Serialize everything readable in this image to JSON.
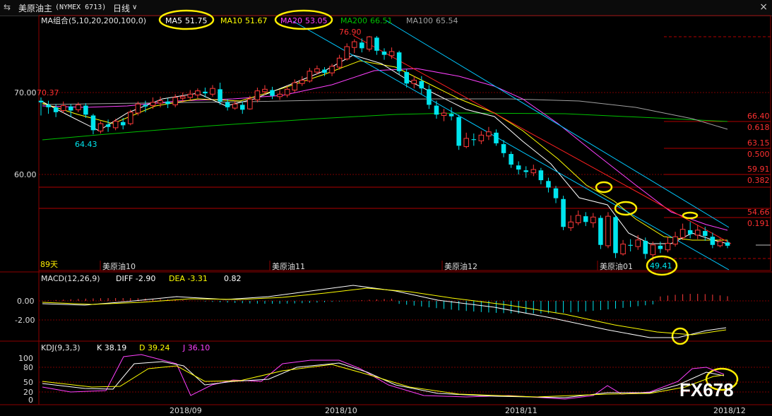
{
  "window": {
    "title": "美原油主",
    "code": "(NYMEX 6713)",
    "period": "日线",
    "close_label": "×"
  },
  "watermark": "FX678",
  "colors": {
    "up": "#ff3a3a",
    "down": "#00e5ee",
    "ma5": "#ffffff",
    "ma10": "#ffff00",
    "ma20": "#ff40ff",
    "ma200": "#00c000",
    "ma100": "#a0a0a0",
    "grid": "#7a0000",
    "annot": "#ffee00"
  },
  "main": {
    "ma_group_label": "MA组合(5,10,20,200,100,0)",
    "legend": [
      {
        "name": "MA5",
        "value": "51.75",
        "color": "#ffffff"
      },
      {
        "name": "MA10",
        "value": "51.67",
        "color": "#ffff00"
      },
      {
        "name": "MA20",
        "value": "53.05",
        "color": "#ff40ff"
      },
      {
        "name": "MA200",
        "value": "66.51",
        "color": "#00c000"
      },
      {
        "name": "MA100",
        "value": "65.54",
        "color": "#a0a0a0"
      }
    ],
    "y_ticks": [
      "70.00",
      "60.00"
    ],
    "annotations": {
      "high": "76.90",
      "low_left": "64.43",
      "low_right": "49.41",
      "p70": "70.37"
    },
    "fib": [
      {
        "price": "66.40",
        "ratio": "0.618"
      },
      {
        "price": "63.15",
        "ratio": "0.500"
      },
      {
        "price": "59.91",
        "ratio": "0.382"
      },
      {
        "price": "54.66",
        "ratio": "0.191"
      }
    ],
    "days_label": "89天",
    "contract_labels": [
      "美原油10",
      "美原油11",
      "美原油12",
      "美原油01"
    ]
  },
  "macd": {
    "title": "MACD(12,26,9)",
    "diff": "DIFF -2.90",
    "dea": "DEA -3.31",
    "macd": "0.82",
    "y_ticks": [
      "0.00",
      "-2.00"
    ]
  },
  "kdj": {
    "title": "KDJ(9,3,3)",
    "k": "K 38.19",
    "d": "D 39.24",
    "j": "J 36.10",
    "y_ticks": [
      "100",
      "80",
      "50",
      "20",
      "0"
    ]
  },
  "x_axis": [
    "2018/09",
    "2018/10",
    "2018/11",
    "2018/12"
  ],
  "chart_data": {
    "type": "candlestick",
    "ylim": [
      49,
      79
    ],
    "candles": [
      [
        69,
        68.8,
        67.2,
        69.4
      ],
      [
        68.5,
        68.2,
        67.4,
        69
      ],
      [
        68.2,
        67.6,
        67,
        68.6
      ],
      [
        67.8,
        68.4,
        67.5,
        68.9
      ],
      [
        68.3,
        67.8,
        67,
        68.6
      ],
      [
        67.9,
        68.5,
        67.6,
        68.8
      ],
      [
        68.4,
        67.3,
        66.9,
        68.7
      ],
      [
        67.2,
        65.4,
        64.9,
        67.4
      ],
      [
        65.3,
        66.2,
        65,
        66.5
      ],
      [
        66.1,
        65.8,
        65.2,
        66.7
      ],
      [
        65.7,
        66.5,
        65.4,
        66.8
      ],
      [
        66.4,
        66,
        65.5,
        66.9
      ],
      [
        66.2,
        67.6,
        66,
        67.9
      ],
      [
        67.5,
        68.6,
        67.2,
        68.9
      ],
      [
        68.5,
        68.3,
        67.6,
        69
      ],
      [
        68.4,
        68.8,
        68,
        69.4
      ],
      [
        68.7,
        69,
        68.2,
        69.5
      ],
      [
        68.9,
        68.6,
        68.1,
        69.3
      ],
      [
        68.5,
        69.4,
        68.2,
        69.8
      ],
      [
        69.3,
        69.5,
        68.8,
        70
      ],
      [
        69.4,
        69.8,
        69.1,
        70.3
      ],
      [
        69.7,
        70.2,
        69.3,
        70.5
      ],
      [
        70.1,
        69.9,
        69.4,
        70.6
      ],
      [
        69.8,
        70.5,
        69.5,
        70.9
      ],
      [
        70.4,
        68.9,
        68.5,
        71.2
      ],
      [
        68.8,
        68.2,
        67.8,
        69.2
      ],
      [
        68.1,
        68.6,
        67.9,
        69
      ],
      [
        68.5,
        67.9,
        67.4,
        68.9
      ],
      [
        68,
        69.2,
        67.9,
        69.6
      ],
      [
        69.1,
        70.2,
        68.8,
        70.6
      ],
      [
        70.1,
        70.4,
        69.7,
        70.9
      ],
      [
        70.3,
        69.6,
        69.2,
        70.7
      ],
      [
        69.5,
        69.8,
        69.1,
        70.3
      ],
      [
        69.7,
        70.4,
        69.4,
        70.8
      ],
      [
        70.3,
        71.2,
        70,
        71.6
      ],
      [
        71.1,
        71.5,
        70.8,
        72
      ],
      [
        71.4,
        72.6,
        71.2,
        73
      ],
      [
        72.5,
        72.9,
        72.2,
        73.3
      ],
      [
        72.8,
        72.4,
        72,
        73.1
      ],
      [
        72.4,
        73.2,
        72,
        73.5
      ],
      [
        73.1,
        74.2,
        72.8,
        74.6
      ],
      [
        74.1,
        75.6,
        73.9,
        76
      ],
      [
        75.5,
        76.2,
        74.8,
        76.5
      ],
      [
        76.1,
        75.4,
        74.9,
        76.6
      ],
      [
        75.3,
        76.8,
        75,
        76.9
      ],
      [
        76.7,
        75.1,
        74.6,
        76.9
      ],
      [
        75,
        74.6,
        74,
        75.4
      ],
      [
        74.5,
        75,
        74.1,
        75.5
      ],
      [
        74.9,
        72.6,
        72.2,
        75.1
      ],
      [
        72.5,
        71.1,
        70.6,
        72.9
      ],
      [
        71.1,
        71.5,
        70.5,
        72
      ],
      [
        71.4,
        70.5,
        69.8,
        72
      ],
      [
        70.4,
        68.5,
        68,
        70.9
      ],
      [
        68.4,
        67.3,
        66.8,
        69
      ],
      [
        67.2,
        67.5,
        66.5,
        68
      ],
      [
        67.4,
        67.1,
        66.6,
        68.2
      ],
      [
        67,
        63.5,
        63,
        67.3
      ],
      [
        63.4,
        64.4,
        63.2,
        65.1
      ],
      [
        64.3,
        64.2,
        63.5,
        65
      ],
      [
        64.1,
        64.8,
        63.7,
        65.3
      ],
      [
        64.7,
        65.2,
        64.2,
        65.8
      ],
      [
        65.1,
        63.8,
        63.5,
        65.5
      ],
      [
        63.7,
        62.6,
        62.1,
        64.2
      ],
      [
        62.5,
        61.2,
        60.8,
        62.8
      ],
      [
        61.1,
        60.6,
        60,
        61.6
      ],
      [
        60.5,
        60.3,
        59.6,
        61
      ],
      [
        60.2,
        60.6,
        59.8,
        61.2
      ],
      [
        60.5,
        59.3,
        58.8,
        60.8
      ],
      [
        59.2,
        58.4,
        57.8,
        59.6
      ],
      [
        58.3,
        57.1,
        56.5,
        58.6
      ],
      [
        57,
        53.6,
        53.2,
        57.4
      ],
      [
        53.5,
        54.2,
        53.1,
        55
      ],
      [
        54.1,
        55,
        53.8,
        55.6
      ],
      [
        54.9,
        54.2,
        53.7,
        55.4
      ],
      [
        54.1,
        54.8,
        53.5,
        55.3
      ],
      [
        54.7,
        51.4,
        50.9,
        55
      ],
      [
        51.3,
        54.9,
        51,
        55.4
      ],
      [
        54.8,
        50.4,
        49.8,
        55
      ],
      [
        50.3,
        51.5,
        50.1,
        52
      ],
      [
        51.4,
        51.3,
        50.6,
        52.1
      ],
      [
        51.2,
        52,
        50.8,
        52.6
      ],
      [
        51.9,
        50.3,
        49.7,
        52.3
      ],
      [
        50.2,
        51.4,
        49.41,
        51.8
      ],
      [
        51.3,
        50.9,
        50.4,
        51.8
      ],
      [
        50.8,
        51.6,
        50.5,
        52.4
      ],
      [
        51.5,
        52.4,
        51.2,
        53
      ],
      [
        52.3,
        53.3,
        52,
        54
      ],
      [
        53.2,
        52.7,
        52.2,
        54.2
      ],
      [
        52.6,
        53.2,
        52.1,
        53.8
      ],
      [
        53.1,
        52.5,
        51.9,
        53.6
      ],
      [
        52.4,
        51.4,
        51,
        52.9
      ],
      [
        51.3,
        51.8,
        51.1,
        52.2
      ],
      [
        51.7,
        51.3,
        51,
        52
      ]
    ]
  }
}
